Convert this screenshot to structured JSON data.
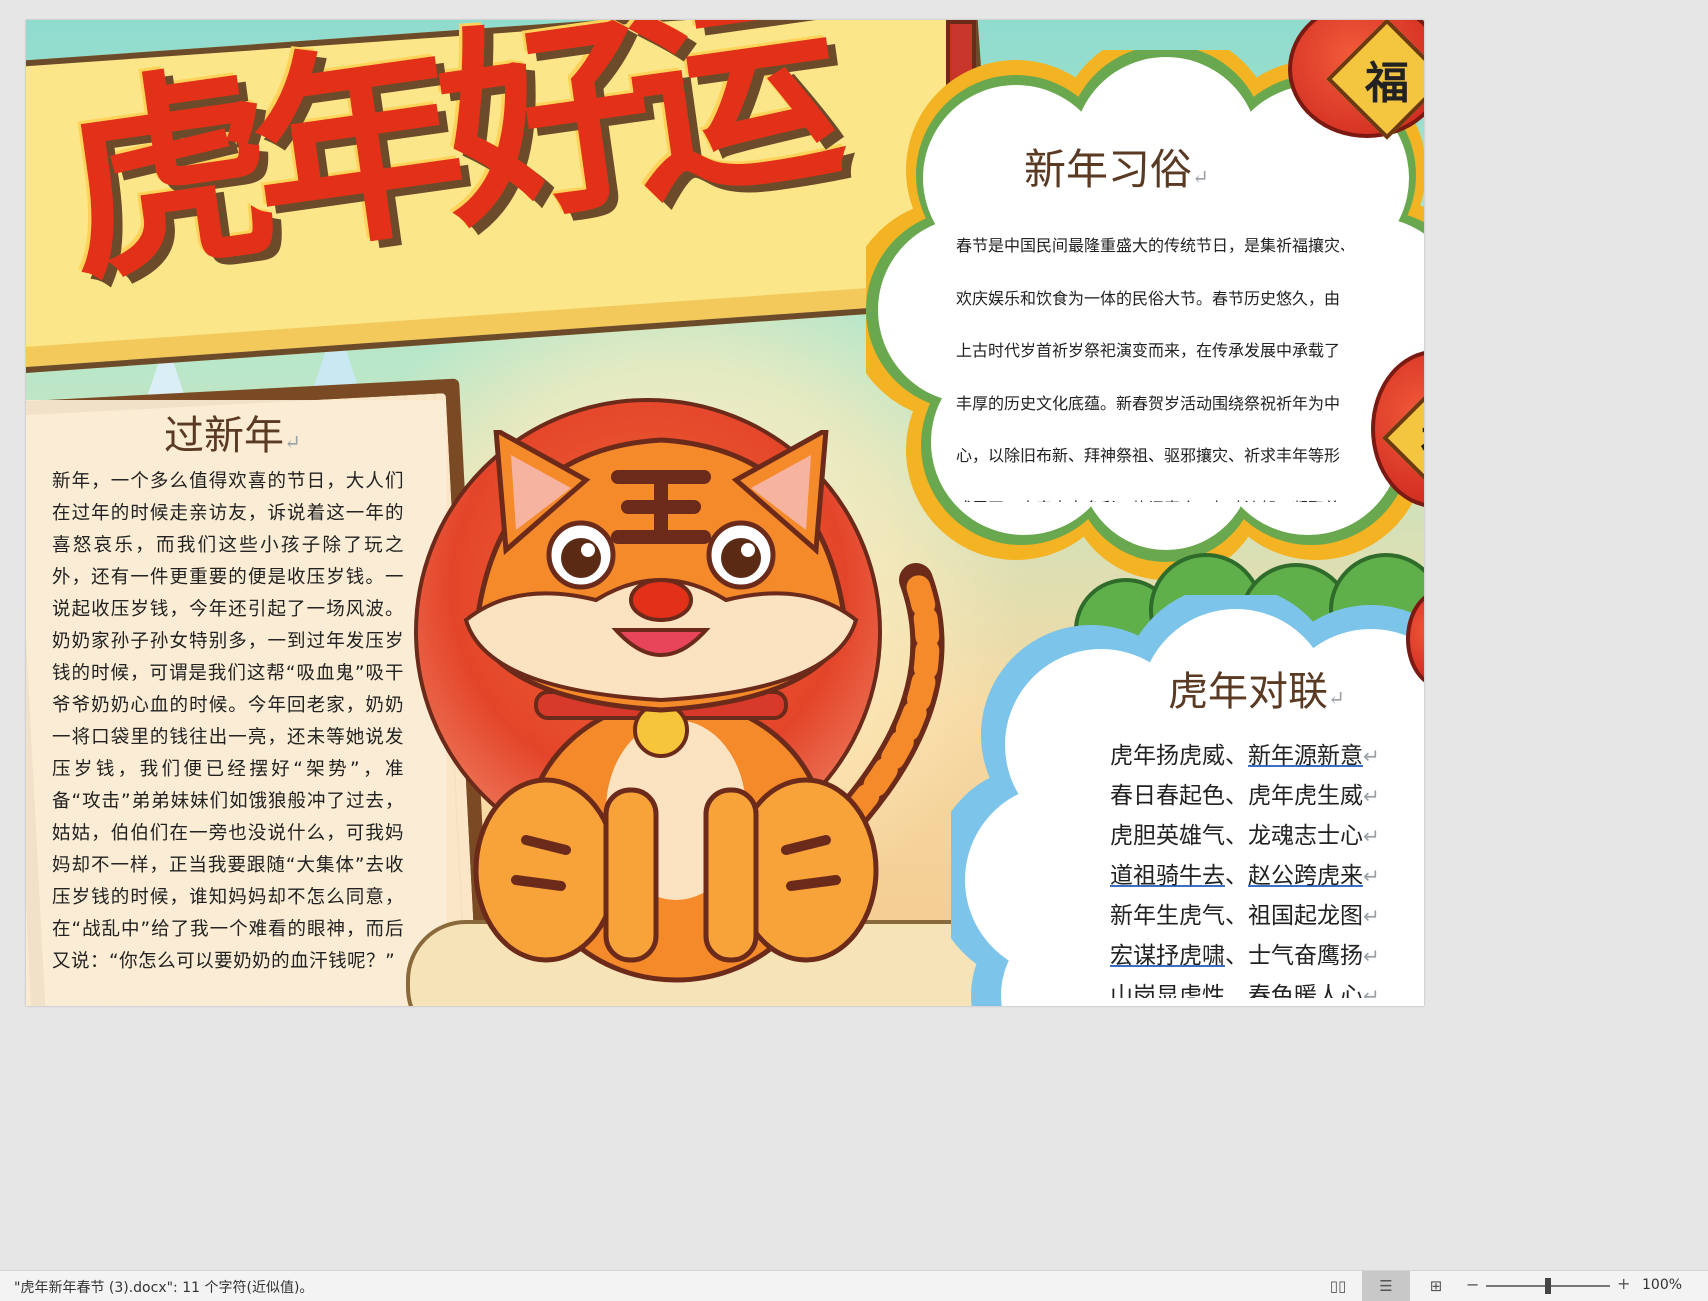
{
  "document": {
    "title": "虎年好运",
    "left_section": {
      "heading": "过新年",
      "body": "新年，一个多么值得欢喜的节日，大人们在过年的时候走亲访友，诉说着这一年的喜怒哀乐，而我们这些小孩子除了玩之外，还有一件更重要的便是收压岁钱。一说起收压岁钱，今年还引起了一场风波。奶奶家孙子孙女特别多，一到过年发压岁钱的时候，可谓是我们这帮“吸血鬼”吸干爷爷奶奶心血的时候。今年回老家，奶奶一将口袋里的钱往出一亮，还未等她说发压岁钱，我们便已经摆好“架势”，准备“攻击”弟弟妹妹们如饿狼般冲了过去，姑姑，伯伯们在一旁也没说什么，可我妈妈却不一样，正当我要跟随“大集体”去收压岁钱的时候，谁知妈妈却不怎么同意，在“战乱中”给了我一个难看的眼神，而后又说：“你怎么可以要奶奶的血汗钱呢？”"
    },
    "customs_section": {
      "heading": "新年习俗",
      "lines": [
        "春节是中国民间最隆重盛大的传统节日，是集祈福攘灾、",
        "欢庆娱乐和饮食为一体的民俗大节。春节历史悠久，由",
        "上古时代岁首祈岁祭祀演变而来，在传承发展中承载了",
        "丰厚的历史文化底蕴。新春贺岁活动围绕祭祝祈年为中",
        "心，以除旧布新、拜神祭祖、驱邪攘灾、祈求丰年等形",
        "式展开，内容丰富多彩，热闹喜庆，年味浓郁，凝聚着"
      ]
    },
    "couplets_section": {
      "heading": "虎年对联",
      "couplets": [
        {
          "a": "虎年扬虎威",
          "sep": "、",
          "b": "新年源新意",
          "a_ul": false,
          "b_ul": true
        },
        {
          "a": "春日春起色",
          "sep": "、",
          "b": "虎年虎生威",
          "a_ul": false,
          "b_ul": false
        },
        {
          "a": "虎胆英雄气",
          "sep": "、",
          "b": "龙魂志士心",
          "a_ul": false,
          "b_ul": false
        },
        {
          "a": "道祖骑牛去",
          "sep": "、",
          "b": "赵公跨虎来",
          "a_ul": true,
          "b_ul": true
        },
        {
          "a": "新年生虎气",
          "sep": "、",
          "b": "祖国起龙图",
          "a_ul": false,
          "b_ul": false
        },
        {
          "a": "宏谋抒虎啸",
          "sep": "、",
          "b": "士气奋鹰扬",
          "a_ul": true,
          "b_ul": false
        },
        {
          "a": "山岗显虎性",
          "sep": "、",
          "b": "春色暖人心",
          "a_ul": false,
          "b_ul": false
        }
      ]
    },
    "lantern_char": "福",
    "paragraph_mark": "↵"
  },
  "statusbar": {
    "text": "\"虎年新年春节 (3).docx\": 11 个字符(近似值)。",
    "zoom_minus": "−",
    "zoom_plus": "+",
    "zoom_level": "100%",
    "zoom_fraction": 0.5
  },
  "colors": {
    "title_red": "#e23118",
    "heading_brown": "#5a3a22",
    "cloud_green": "#6aa84f",
    "cloud_orange": "#f4b323",
    "cloud_blue": "#7cc4ea",
    "tiger_orange": "#f48a2a"
  },
  "icons": [
    "read-mode-icon",
    "print-layout-icon",
    "web-layout-icon"
  ]
}
